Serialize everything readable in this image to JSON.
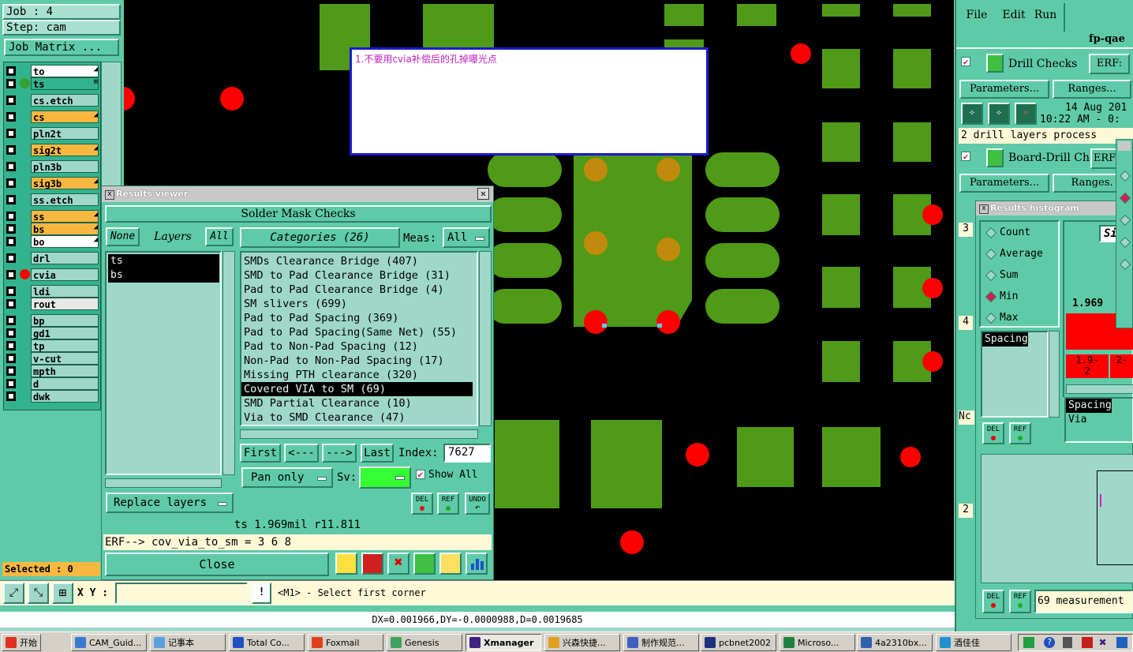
{
  "job_panel": {
    "job": "Job : 4",
    "step": "Step: cam",
    "matrix_btn": "Job Matrix ..."
  },
  "layers": [
    {
      "name": "to",
      "color": "#ffffff",
      "marker": "◢"
    },
    {
      "name": "ts",
      "color": "#33b38d",
      "marker": "⊞"
    },
    {
      "name": "cs.etch",
      "color": "#9fd8c8",
      "marker": ""
    },
    {
      "name": "cs",
      "color": "#f8b840",
      "marker": "◢"
    },
    {
      "name": "pln2t",
      "color": "#9fd8c8",
      "marker": ""
    },
    {
      "name": "sig2t",
      "color": "#f8b840",
      "marker": "◢"
    },
    {
      "name": "pln3b",
      "color": "#9fd8c8",
      "marker": ""
    },
    {
      "name": "sig3b",
      "color": "#f8b840",
      "marker": "◢"
    },
    {
      "name": "ss.etch",
      "color": "#9fd8c8",
      "marker": ""
    },
    {
      "name": "ss",
      "color": "#f8b840",
      "marker": "◢"
    },
    {
      "name": "bs",
      "color": "#f8b840",
      "marker": "◢"
    },
    {
      "name": "bo",
      "color": "#ffffff",
      "marker": "◢"
    },
    {
      "name": "drl",
      "color": "#9fd8c8",
      "marker": ""
    },
    {
      "name": "cvia",
      "color": "#9fd8c8",
      "marker": ""
    },
    {
      "name": "ldi",
      "color": "#9fd8c8",
      "marker": ""
    },
    {
      "name": "rout",
      "color": "#e8e8e8",
      "marker": ""
    },
    {
      "name": "bp",
      "color": "#9fd8c8",
      "marker": ""
    },
    {
      "name": "gd1",
      "color": "#9fd8c8",
      "marker": ""
    },
    {
      "name": "tp",
      "color": "#9fd8c8",
      "marker": ""
    },
    {
      "name": "v-cut",
      "color": "#9fd8c8",
      "marker": ""
    },
    {
      "name": "mpth",
      "color": "#9fd8c8",
      "marker": ""
    },
    {
      "name": "d",
      "color": "#9fd8c8",
      "marker": ""
    },
    {
      "name": "dwk",
      "color": "#9fd8c8",
      "marker": ""
    }
  ],
  "selected": "Selected : 0",
  "note": "1.不要用cvia补偿后的孔掉曝光点",
  "results": {
    "title": "Results viewer",
    "header": "Solder Mask Checks",
    "none": "None",
    "layers": "Layers",
    "all": "All",
    "layer_list": [
      "ts",
      "bs"
    ],
    "categories": "Categories (26)",
    "meas_label": "Meas:",
    "meas_value": "All",
    "items": [
      "SMDs Clearance Bridge (407)",
      "SMD to Pad Clearance Bridge (31)",
      "Pad to Pad Clearance Bridge (4)",
      "SM slivers (699)",
      "Pad to Pad Spacing (369)",
      "Pad to Pad Spacing(Same Net) (55)",
      "Pad to Non-Pad Spacing (12)",
      "Non-Pad to Non-Pad Spacing (17)",
      "Missing PTH clearance (320)",
      "Covered VIA to SM (69)",
      "SMD Partial Clearance (10)",
      "Via to SMD Clearance (47)"
    ],
    "first": "First",
    "prev": "<---",
    "next": "--->",
    "last": "Last",
    "index_label": "Index:",
    "index_value": "7627",
    "pan": "Pan only",
    "sv": "Sv:",
    "show_all": "Show All",
    "replace": "Replace layers",
    "del": "DEL",
    "ref": "REF",
    "undo": "UNDO",
    "status": "ts 1.969mil  r11.811",
    "erf": "ERF--> cov_via_to_sm = 3 6 8",
    "close": "Close"
  },
  "bottom": {
    "xy_label": "X Y :",
    "hint": "<M1> - Select first corner",
    "measure": "DX=0.001966,DY=-0.0000988,D=0.0019685"
  },
  "right": {
    "menu": [
      "File",
      "Edit",
      "Run"
    ],
    "host": "fp-qae",
    "drill_checks": "Drill Checks",
    "erf": "ERF:",
    "parameters": "Parameters...",
    "ranges": "Ranges...",
    "date": "14 Aug 201",
    "time": "10:22 AM - 0:",
    "processed": "2 drill layers process",
    "board_drill": "Board-Drill Che",
    "erf2": "ERF",
    "parameters2": "Parameters...",
    "ranges2": "Ranges.",
    "side_numbers": [
      "3",
      "4",
      "2"
    ],
    "nc": "Nc"
  },
  "histogram": {
    "title": "Results histogram",
    "options": [
      "Count",
      "Average",
      "Sum",
      "Min",
      "Max"
    ],
    "selected_option": "Min",
    "list": [
      "Spacing"
    ],
    "value": "1.969",
    "si": "Si",
    "bins": [
      "1.9-\n2",
      "2-"
    ],
    "sel_list": [
      "Spacing",
      "Via"
    ],
    "del": "DEL",
    "ref": "REF",
    "measurements": "69 measurement"
  },
  "taskbar": [
    {
      "label": "开始",
      "color": "#e03020"
    },
    {
      "label": "CAM_Guid...",
      "color": "#3a7ad0"
    },
    {
      "label": "记事本",
      "color": "#5aa0e0"
    },
    {
      "label": "Total Co...",
      "color": "#2050c0"
    },
    {
      "label": "Foxmail",
      "color": "#e04020"
    },
    {
      "label": "Genesis",
      "color": "#40a060"
    },
    {
      "label": "Xmanager",
      "color": "#402080"
    },
    {
      "label": "兴森快捷...",
      "color": "#e0a020"
    },
    {
      "label": "制作规范...",
      "color": "#4060c0"
    },
    {
      "label": "pcbnet2002",
      "color": "#203080"
    },
    {
      "label": "Microso...",
      "color": "#208040"
    },
    {
      "label": "4a2310bx...",
      "color": "#3060b0"
    },
    {
      "label": "酒佳佳",
      "color": "#2090d0"
    }
  ]
}
